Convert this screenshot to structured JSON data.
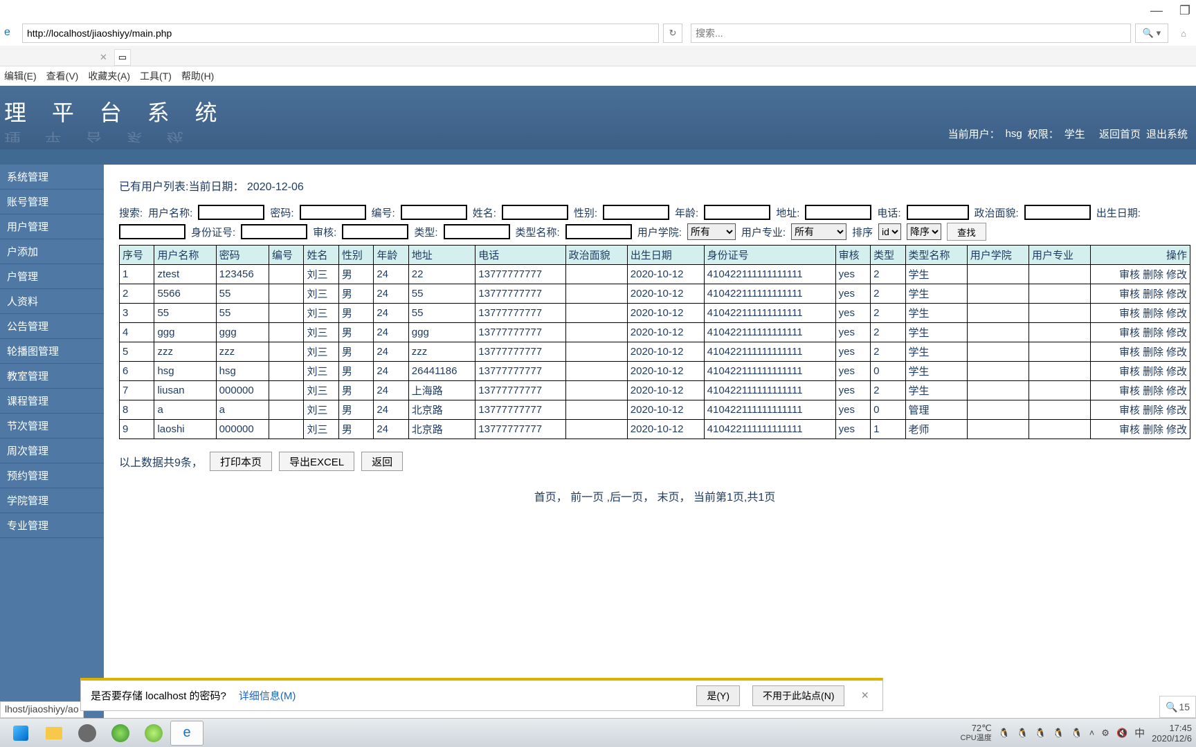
{
  "window": {
    "minimize": "—",
    "maximize": "▢",
    "close": ""
  },
  "address": {
    "url": "http://localhost/jiaoshiyy/main.php",
    "search_placeholder": "搜索..."
  },
  "menubar": [
    "编辑(E)",
    "查看(V)",
    "收藏夹(A)",
    "工具(T)",
    "帮助(H)"
  ],
  "banner": {
    "title": "理 平 台 系 统",
    "user_label": "当前用户：",
    "user": "hsg",
    "role_label": "权限：",
    "role": "学生",
    "home": "返回首页",
    "logout": "退出系统"
  },
  "sidebar": {
    "items": [
      "系统管理",
      "账号管理",
      "用户管理",
      "户添加",
      "户管理",
      "人资料",
      "公告管理",
      "轮播图管理",
      "教室管理",
      "课程管理",
      "节次管理",
      "周次管理",
      "预约管理",
      "学院管理",
      "专业管理"
    ]
  },
  "page": {
    "list_title_prefix": "已有用户列表:当前日期：",
    "current_date": "2020-12-06",
    "search_labels": {
      "search": "搜索:",
      "username": "用户名称:",
      "password": "密码:",
      "number": "编号:",
      "name": "姓名:",
      "gender": "性别:",
      "age": "年龄:",
      "address": "地址:",
      "phone": "电话:",
      "politics": "政治面貌:",
      "birth": "出生日期:",
      "idcard": "身份证号:",
      "audit": "审核:",
      "type": "类型:",
      "typename": "类型名称:",
      "college": "用户学院:",
      "major": "用户专业:",
      "sort": "排序"
    },
    "select_all": "所有",
    "sort_field": "id",
    "sort_dir": "降序",
    "search_btn": "查找",
    "columns": [
      "序号",
      "用户名称",
      "密码",
      "编号",
      "姓名",
      "性别",
      "年龄",
      "地址",
      "电话",
      "政治面貌",
      "出生日期",
      "身份证号",
      "审核",
      "类型",
      "类型名称",
      "用户学院",
      "用户专业",
      "操作"
    ],
    "ops": {
      "audit": "审核",
      "delete": "删除",
      "edit": "修改"
    },
    "rows": [
      {
        "idx": "1",
        "username": "ztest",
        "password": "123456",
        "number": "",
        "name": "刘三",
        "gender": "男",
        "age": "24",
        "address": "22",
        "phone": "13777777777",
        "politics": "",
        "birth": "2020-10-12",
        "idcard": "410422111111111111",
        "audit": "yes",
        "type": "2",
        "typename": "学生",
        "college": "",
        "major": ""
      },
      {
        "idx": "2",
        "username": "5566",
        "password": "55",
        "number": "",
        "name": "刘三",
        "gender": "男",
        "age": "24",
        "address": "55",
        "phone": "13777777777",
        "politics": "",
        "birth": "2020-10-12",
        "idcard": "410422111111111111",
        "audit": "yes",
        "type": "2",
        "typename": "学生",
        "college": "",
        "major": ""
      },
      {
        "idx": "3",
        "username": "55",
        "password": "55",
        "number": "",
        "name": "刘三",
        "gender": "男",
        "age": "24",
        "address": "55",
        "phone": "13777777777",
        "politics": "",
        "birth": "2020-10-12",
        "idcard": "410422111111111111",
        "audit": "yes",
        "type": "2",
        "typename": "学生",
        "college": "",
        "major": ""
      },
      {
        "idx": "4",
        "username": "ggg",
        "password": "ggg",
        "number": "",
        "name": "刘三",
        "gender": "男",
        "age": "24",
        "address": "ggg",
        "phone": "13777777777",
        "politics": "",
        "birth": "2020-10-12",
        "idcard": "410422111111111111",
        "audit": "yes",
        "type": "2",
        "typename": "学生",
        "college": "",
        "major": ""
      },
      {
        "idx": "5",
        "username": "zzz",
        "password": "zzz",
        "number": "",
        "name": "刘三",
        "gender": "男",
        "age": "24",
        "address": "zzz",
        "phone": "13777777777",
        "politics": "",
        "birth": "2020-10-12",
        "idcard": "410422111111111111",
        "audit": "yes",
        "type": "2",
        "typename": "学生",
        "college": "",
        "major": ""
      },
      {
        "idx": "6",
        "username": "hsg",
        "password": "hsg",
        "number": "",
        "name": "刘三",
        "gender": "男",
        "age": "24",
        "address": "26441186",
        "phone": "13777777777",
        "politics": "",
        "birth": "2020-10-12",
        "idcard": "410422111111111111",
        "audit": "yes",
        "type": "0",
        "typename": "学生",
        "college": "",
        "major": ""
      },
      {
        "idx": "7",
        "username": "liusan",
        "password": "000000",
        "number": "",
        "name": "刘三",
        "gender": "男",
        "age": "24",
        "address": "上海路",
        "phone": "13777777777",
        "politics": "",
        "birth": "2020-10-12",
        "idcard": "410422111111111111",
        "audit": "yes",
        "type": "2",
        "typename": "学生",
        "college": "",
        "major": ""
      },
      {
        "idx": "8",
        "username": "a",
        "password": "a",
        "number": "",
        "name": "刘三",
        "gender": "男",
        "age": "24",
        "address": "北京路",
        "phone": "13777777777",
        "politics": "",
        "birth": "2020-10-12",
        "idcard": "410422111111111111",
        "audit": "yes",
        "type": "0",
        "typename": "管理",
        "college": "",
        "major": ""
      },
      {
        "idx": "9",
        "username": "laoshi",
        "password": "000000",
        "number": "",
        "name": "刘三",
        "gender": "男",
        "age": "24",
        "address": "北京路",
        "phone": "13777777777",
        "politics": "",
        "birth": "2020-10-12",
        "idcard": "410422111111111111",
        "audit": "yes",
        "type": "1",
        "typename": "老师",
        "college": "",
        "major": ""
      }
    ],
    "summary_prefix": "以上数据共",
    "summary_count": "9",
    "summary_suffix": "条，",
    "print": "打印本页",
    "export": "导出EXCEL",
    "back": "返回",
    "pager": "首页， 前一页 ,后一页， 末页， 当前第1页,共1页"
  },
  "savepw": {
    "msg": "是否要存储 localhost 的密码?",
    "details": "详细信息(M)",
    "yes": "是(Y)",
    "no": "不用于此站点(N)"
  },
  "statusbar_url": "lhost/jiaoshiyy/ao",
  "zoom": "15",
  "taskbar": {
    "temp": "72℃",
    "temp_label": "CPU温度",
    "ime": "中",
    "time": "17:45",
    "date": "2020/12/6"
  }
}
